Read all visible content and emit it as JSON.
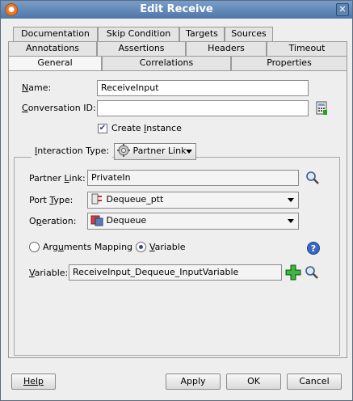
{
  "window": {
    "title": "Edit Receive"
  },
  "tabs": {
    "row1": [
      "Documentation",
      "Skip Condition",
      "Targets",
      "Sources"
    ],
    "row2": [
      "Annotations",
      "Assertions",
      "Headers",
      "Timeout"
    ],
    "row3": [
      "General",
      "Correlations",
      "Properties"
    ],
    "active": "General"
  },
  "general": {
    "name_label": "Name:",
    "name_value": "ReceiveInput",
    "conversation_label": "Conversation ID:",
    "conversation_value": "",
    "create_instance_label": "Create Instance",
    "create_instance_checked": true,
    "interaction_type_label": "Interaction Type:",
    "interaction_type_value": "Partner Link",
    "partner_link_label": "Partner Link:",
    "partner_link_value": "PrivateIn",
    "port_type_label": "Port Type:",
    "port_type_value": "Dequeue_ptt",
    "operation_label": "Operation:",
    "operation_value": "Dequeue",
    "arguments_mapping_label": "Arguments Mapping",
    "variable_radio_label": "Variable",
    "selected_mode": "Variable",
    "variable_label": "Variable:",
    "variable_value": "ReceiveInput_Dequeue_InputVariable"
  },
  "buttons": {
    "help": "Help",
    "apply": "Apply",
    "ok": "OK",
    "cancel": "Cancel"
  },
  "colors": {
    "titlebar": "#4e76a8",
    "accent_green": "#2e9a2e",
    "help_blue": "#3a68c8"
  }
}
